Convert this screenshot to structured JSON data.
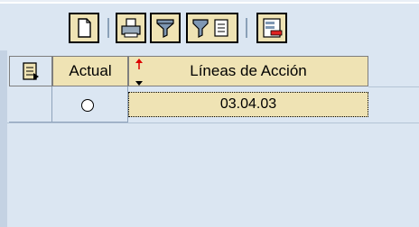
{
  "toolbar": {
    "buttons": [
      {
        "name": "new-document-button",
        "icon": "document-icon"
      },
      {
        "name": "print-button",
        "icon": "printer-icon"
      },
      {
        "name": "filter-button",
        "icon": "filter-icon"
      },
      {
        "name": "filter-settings-button",
        "icon": "filter-settings-icon"
      },
      {
        "name": "layout-button",
        "icon": "layout-icon"
      }
    ]
  },
  "table": {
    "columns": [
      "Actual",
      "Líneas de Acción"
    ],
    "rows": [
      {
        "actual": "",
        "lineas_de_accion": "03.04.03"
      }
    ],
    "select_all_icon": "select-all-icon",
    "sort_icon": "sort-icon"
  },
  "colors": {
    "toolbar_bg": "#dbe6f2",
    "button_bg": "#efe3b4",
    "header_bg": "#efe3b4",
    "grid_bg": "#dbe6f2"
  }
}
